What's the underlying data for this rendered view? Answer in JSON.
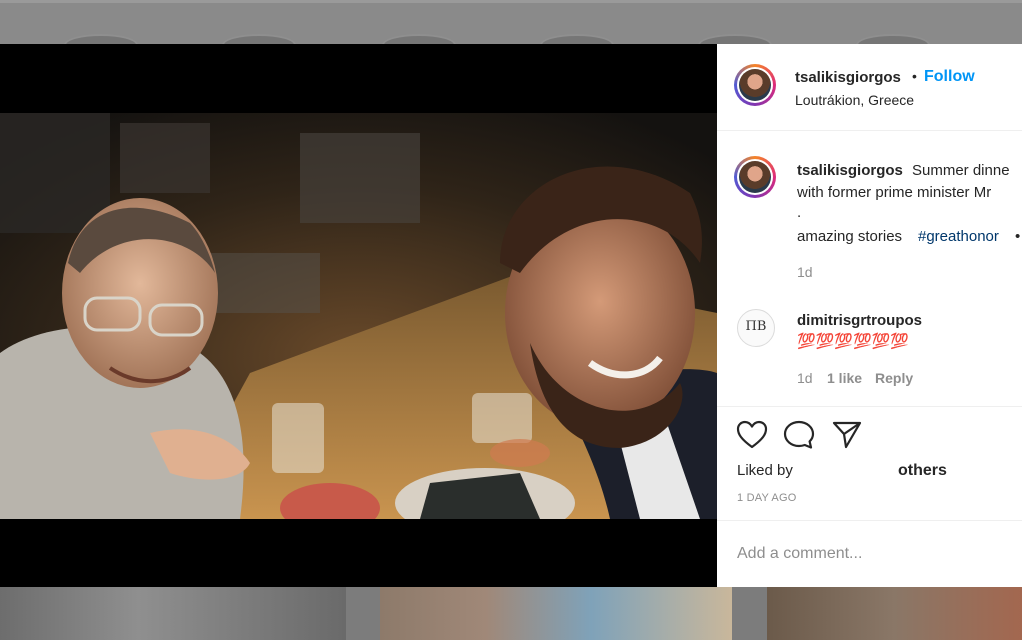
{
  "post": {
    "username": "tsalikisgiorgos",
    "separator": "•",
    "follow_label": "Follow",
    "location": "Loutrákion, Greece"
  },
  "caption": {
    "username": "tsalikisgiorgos",
    "line1": "Summer dinne",
    "line2": "with former prime minister Mr",
    "line3": ".",
    "line4_text": "amazing stories",
    "hashtag": "#greathonor",
    "line4_tail": "•",
    "time": "1d"
  },
  "comment": {
    "username": "dimitrisgrtroupos",
    "emojis": "💯💯💯💯💯💯",
    "avatar_letters": "ΠΒ",
    "time": "1d",
    "likes": "1 like",
    "reply": "Reply"
  },
  "actions": {
    "like_icon": "heart-icon",
    "comment_icon": "comment-icon",
    "share_icon": "share-icon"
  },
  "likes": {
    "prefix": "Liked by",
    "suffix": "others"
  },
  "timestamp": "1 DAY AGO",
  "add_comment": {
    "placeholder": "Add a comment..."
  }
}
